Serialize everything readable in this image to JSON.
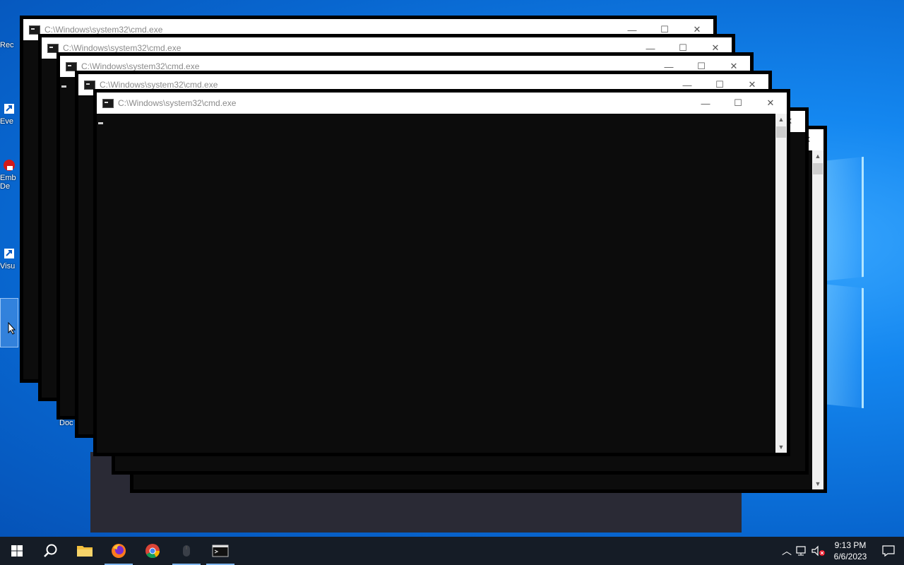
{
  "window_title": "C:\\Windows\\system32\\cmd.exe",
  "controls": {
    "minimize": "—",
    "maximize": "☐",
    "close": "✕"
  },
  "desktop_icons": [
    {
      "name": "recycle-bin",
      "label": "Rec"
    },
    {
      "name": "event-shortcut",
      "label": "Eve"
    },
    {
      "name": "ember-shortcut",
      "label": "Emb\nDe"
    },
    {
      "name": "visual-shortcut",
      "label": "Visu"
    },
    {
      "name": "documents-shortcut",
      "label": "Doc"
    }
  ],
  "taskbar": {
    "apps": [
      "start",
      "search",
      "file-explorer",
      "firefox",
      "chrome",
      "mouse-app",
      "command-prompt"
    ]
  },
  "clock": {
    "time": "9:13 PM",
    "date": "6/6/2023"
  },
  "colors": {
    "taskbar": "#151c26",
    "console": "#0c0c0c",
    "desktop": "#0a6fd6"
  }
}
